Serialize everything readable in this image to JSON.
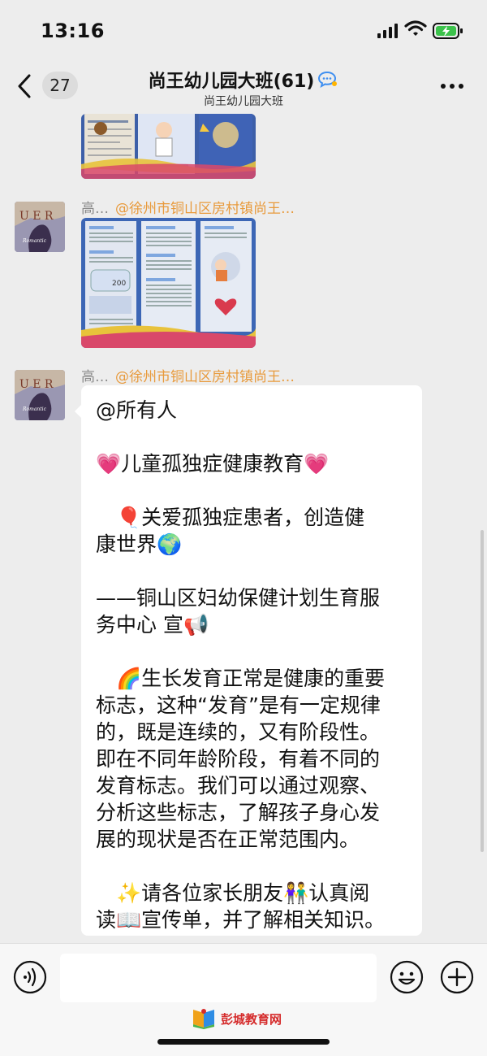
{
  "status": {
    "time": "13:16"
  },
  "header": {
    "unread": "27",
    "title": "尚王幼儿园大班(61)",
    "subtitle": "尚王幼儿园大班"
  },
  "messages": [
    {
      "sender": "高…",
      "mention": "@徐州市铜山区房村镇尚王…"
    },
    {
      "sender": "高…",
      "mention": "@徐州市铜山区房村镇尚王…"
    }
  ],
  "bubble": {
    "lines": [
      "@所有人",
      "",
      "💗儿童孤独症健康教育💗",
      "",
      "　🎈关爱孤独症患者，创造健",
      "康世界🌍",
      "",
      "——铜山区妇幼保健计划生育服",
      "务中心 宣📢",
      "",
      "　🌈生长发育正常是健康的重要",
      "标志，这种“发育”是有一定规律",
      "的，既是连续的，又有阶段性。",
      "即在不同年龄阶段，有着不同的",
      "发育标志。我们可以通过观察、",
      "分析这些标志，了解孩子身心发",
      "展的现状是否在正常范围内。",
      "",
      "　✨请各位家长朋友👫认真阅",
      "读📖宣传单，并了解相关知识。"
    ]
  },
  "watermark": {
    "text": "彭城教育网"
  },
  "colors": {
    "mention": "#e89a3c",
    "background": "#ededed",
    "bubble": "#ffffff",
    "watermark": "#d52b2b"
  },
  "icons": [
    "signal-icon",
    "wifi-icon",
    "battery-icon",
    "back-icon",
    "chat-badge-icon",
    "more-icon",
    "voice-icon",
    "emoji-icon",
    "plus-icon",
    "book-logo-icon"
  ]
}
